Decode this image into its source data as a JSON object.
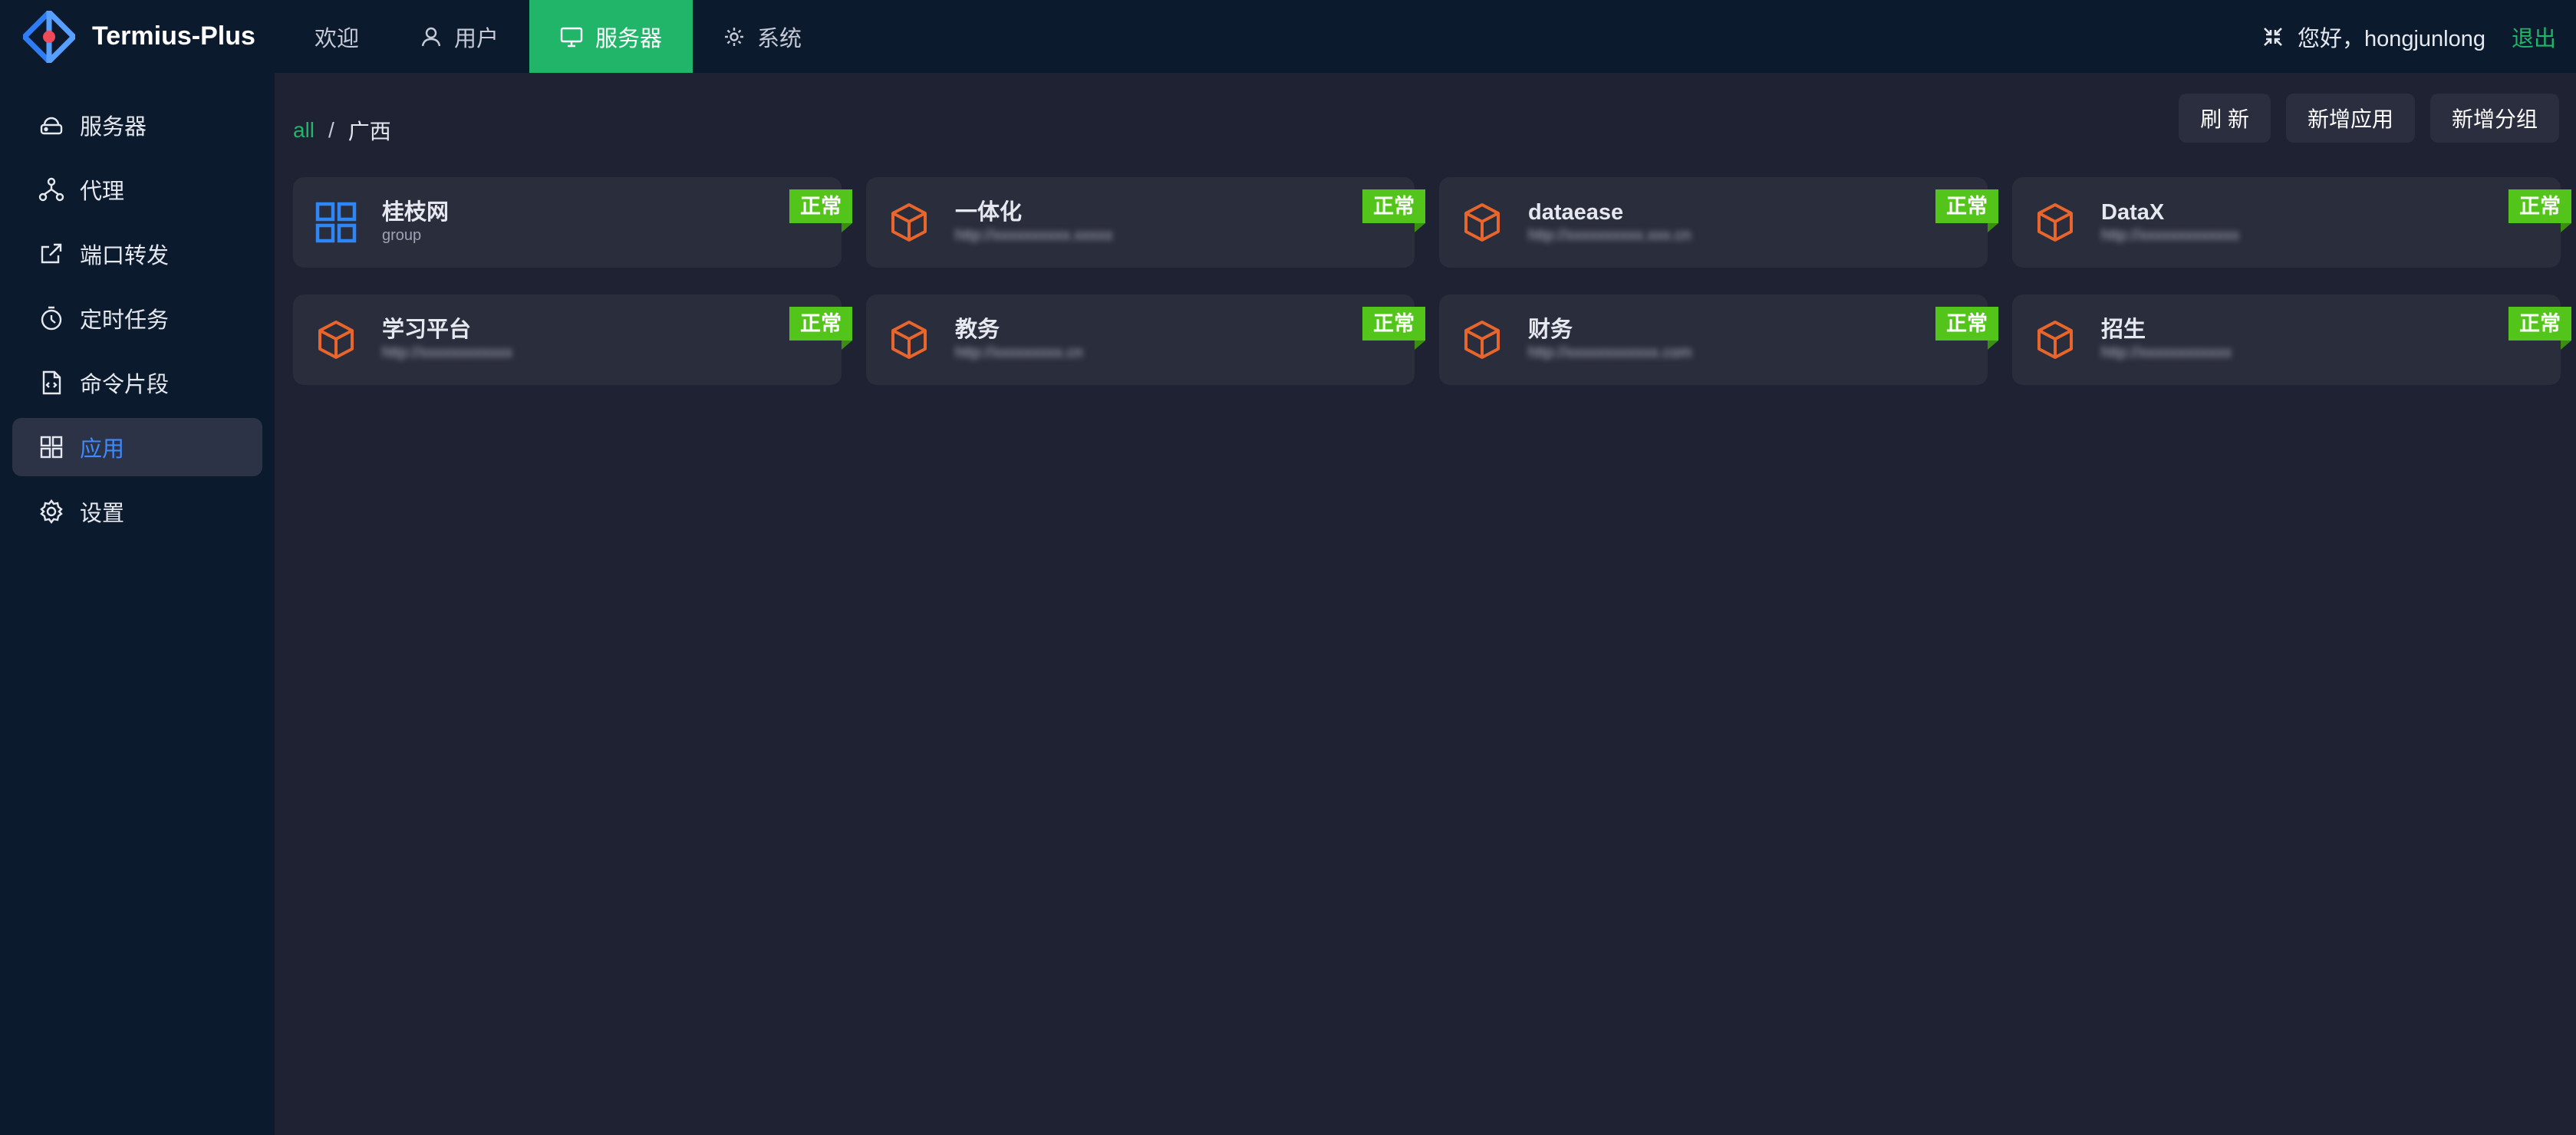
{
  "app": {
    "name": "Termius-Plus"
  },
  "topnav": {
    "items": [
      {
        "label": "欢迎",
        "icon": "none"
      },
      {
        "label": "用户",
        "icon": "user-icon"
      },
      {
        "label": "服务器",
        "icon": "monitor-icon",
        "active": true
      },
      {
        "label": "系统",
        "icon": "gear-icon"
      }
    ]
  },
  "user": {
    "greeting": "您好，hongjunlong",
    "logout": "退出"
  },
  "sidebar": {
    "items": [
      {
        "label": "服务器",
        "icon": "cloud-server-icon"
      },
      {
        "label": "代理",
        "icon": "cluster-icon"
      },
      {
        "label": "端口转发",
        "icon": "export-icon"
      },
      {
        "label": "定时任务",
        "icon": "timer-icon"
      },
      {
        "label": "命令片段",
        "icon": "code-file-icon"
      },
      {
        "label": "应用",
        "icon": "apps-icon",
        "active": true
      },
      {
        "label": "设置",
        "icon": "settings-icon"
      }
    ]
  },
  "breadcrumb": {
    "root": "all",
    "separator": "/",
    "current": "广西"
  },
  "toolbar": {
    "refresh": "刷 新",
    "add_app": "新增应用",
    "add_group": "新增分组"
  },
  "cards": [
    {
      "title": "桂枝网",
      "subtitle": "group",
      "status": "正常",
      "icon": "group-grid-icon",
      "blurred": false
    },
    {
      "title": "一体化",
      "subtitle": "http://xxxxxxxxxx.xxxxx",
      "status": "正常",
      "icon": "cube-icon",
      "blurred": true
    },
    {
      "title": "dataease",
      "subtitle": "http://xxxxxxxxxx.xxx.cn",
      "status": "正常",
      "icon": "cube-icon",
      "blurred": true
    },
    {
      "title": "DataX",
      "subtitle": "http://xxxxxxxxxxxxx",
      "status": "正常",
      "icon": "cube-icon",
      "blurred": true
    },
    {
      "title": "学习平台",
      "subtitle": "http://xxxxxxxxxxxx",
      "status": "正常",
      "icon": "cube-icon",
      "blurred": true
    },
    {
      "title": "教务",
      "subtitle": "http://xxxxxxxxx.cn",
      "status": "正常",
      "icon": "cube-icon",
      "blurred": true
    },
    {
      "title": "财务",
      "subtitle": "http://xxxxxxxxxxxx.com",
      "status": "正常",
      "icon": "cube-icon",
      "blurred": true
    },
    {
      "title": "招生",
      "subtitle": "http://xxxxxxxxxxxx",
      "status": "正常",
      "icon": "cube-icon",
      "blurred": true
    }
  ],
  "colors": {
    "accent_green": "#21b56a",
    "status_green": "#52c41a",
    "active_blue": "#3d8bff",
    "cube_orange": "#e8652c",
    "nav_bg": "#0b1a2c",
    "content_bg": "#1f2232",
    "card_bg": "#2a2d3c"
  }
}
